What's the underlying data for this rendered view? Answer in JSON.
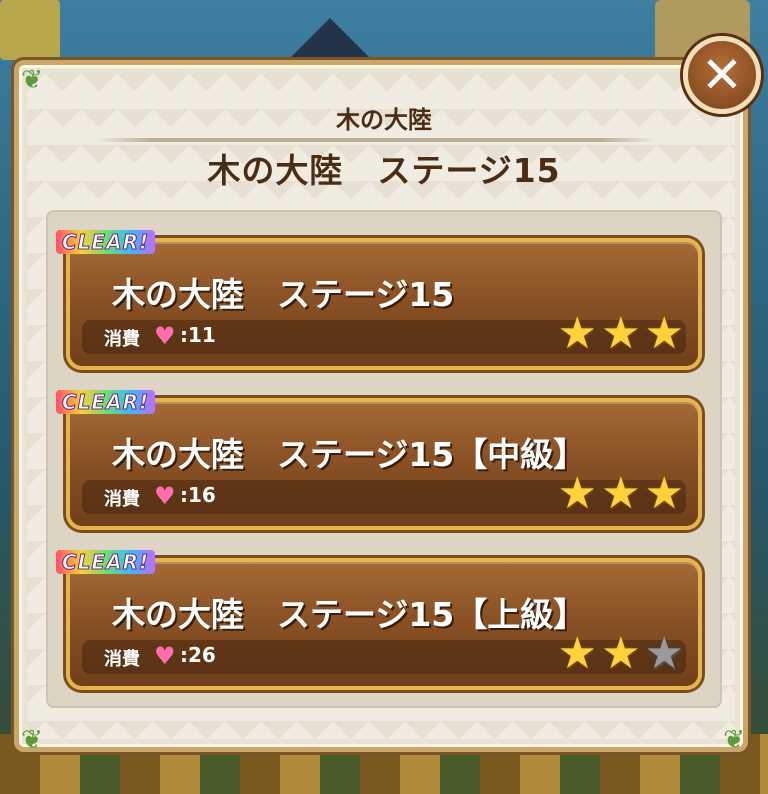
{
  "dialog": {
    "subtitle": "木の大陸",
    "title": "木の大陸　ステージ15",
    "close_label": "✕"
  },
  "stages": [
    {
      "clear_badge": "CLEAR!",
      "name": "木の大陸　ステージ15",
      "cost_label": "消費",
      "cost_value": ":11",
      "stars": 3
    },
    {
      "clear_badge": "CLEAR!",
      "name": "木の大陸　ステージ15【中級】",
      "cost_label": "消費",
      "cost_value": ":16",
      "stars": 3
    },
    {
      "clear_badge": "CLEAR!",
      "name": "木の大陸　ステージ15【上級】",
      "cost_label": "消費",
      "cost_value": ":26",
      "stars": 2
    }
  ],
  "max_stars": 3,
  "colors": {
    "accent_gold": "#e6b54a",
    "panel_brown": "#8a5226",
    "heart": "#ff6fb0",
    "star_on": "#ffd23a",
    "star_off": "#9a9a9a"
  },
  "icons": {
    "close": "close-icon",
    "heart": "heart-icon",
    "star": "star-icon",
    "leaf": "leaf-icon"
  }
}
